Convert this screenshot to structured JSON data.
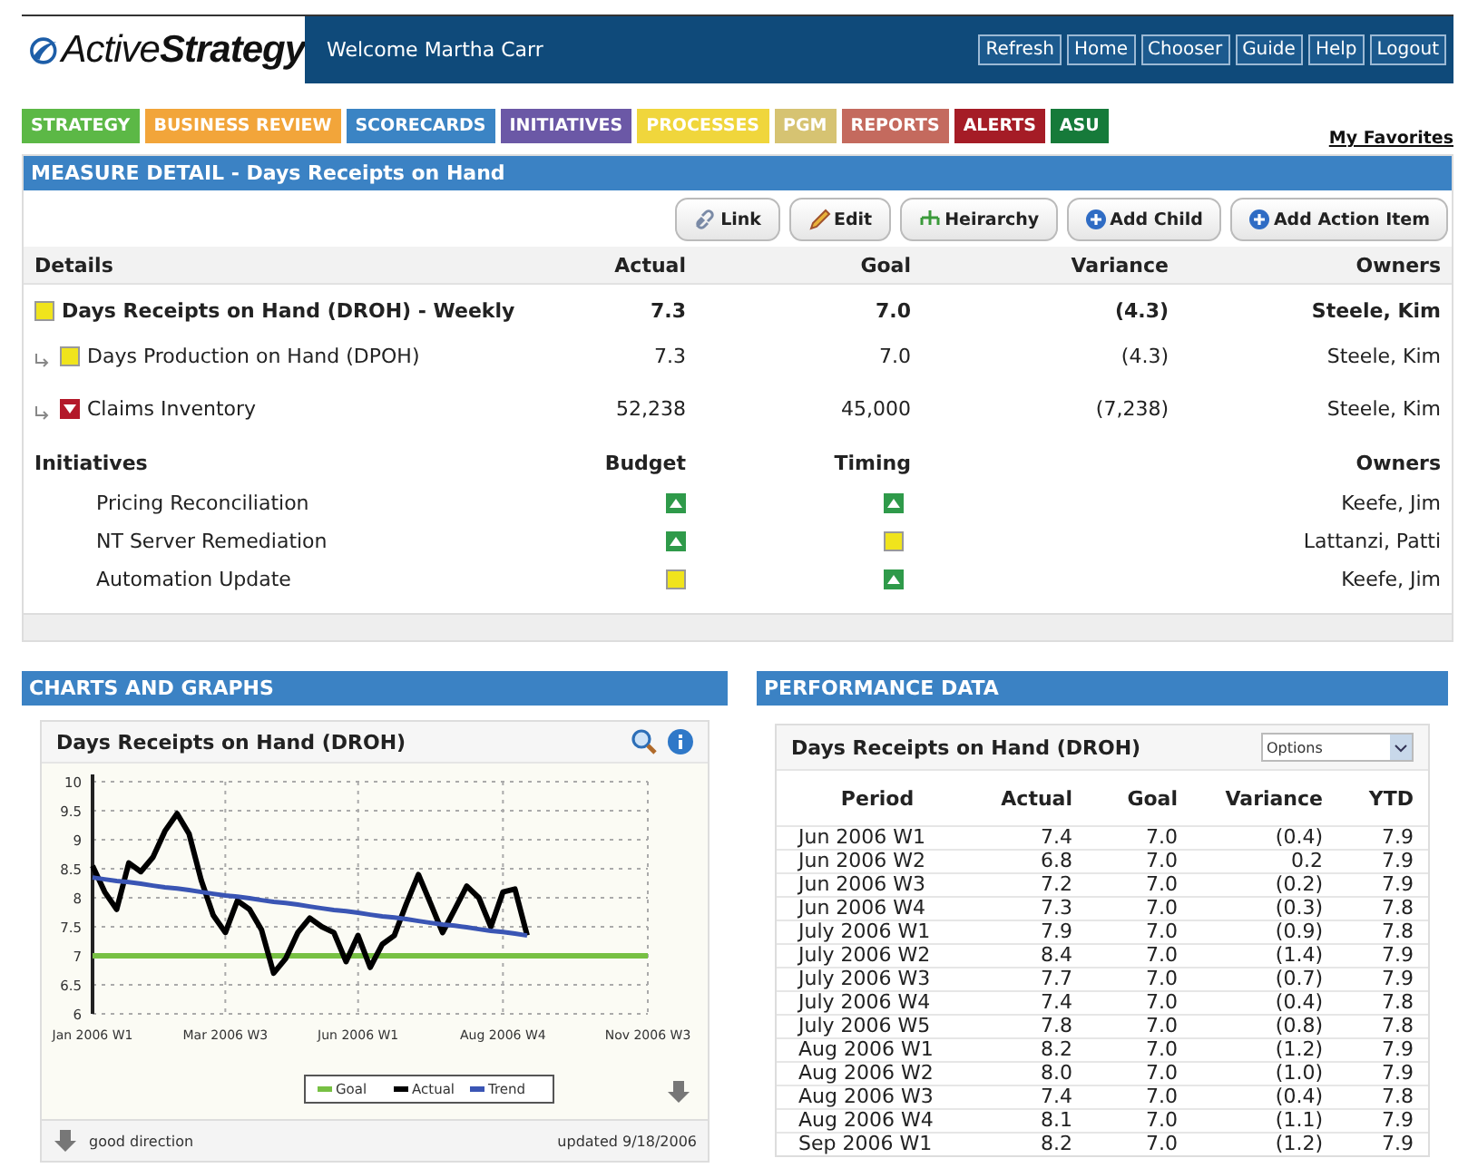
{
  "header": {
    "logo": {
      "word1": "Active",
      "word2": "Strategy"
    },
    "welcome": "Welcome Martha Carr",
    "buttons": [
      "Refresh",
      "Home",
      "Chooser",
      "Guide",
      "Help",
      "Logout"
    ]
  },
  "tabs": [
    {
      "label": "STRATEGY",
      "color": "#5cb846"
    },
    {
      "label": "BUSINESS REVIEW",
      "color": "#f2a53a"
    },
    {
      "label": "SCORECARDS",
      "color": "#3b84c4"
    },
    {
      "label": "INITIATIVES",
      "color": "#6b58a6"
    },
    {
      "label": "PROCESSES",
      "color": "#f0d63c"
    },
    {
      "label": "PGM",
      "color": "#d6c372"
    },
    {
      "label": "REPORTS",
      "color": "#c46a5e"
    },
    {
      "label": "ALERTS",
      "color": "#a51c26"
    },
    {
      "label": "ASU",
      "color": "#167a3a"
    }
  ],
  "favorites": "My Favorites",
  "measure_detail": {
    "title": "MEASURE DETAIL - Days Receipts on Hand",
    "actions": [
      {
        "label": "Link",
        "kind": "link"
      },
      {
        "label": "Edit",
        "kind": "edit"
      },
      {
        "label": "Heirarchy",
        "kind": "hierarchy"
      },
      {
        "label": "Add Child",
        "kind": "add"
      },
      {
        "label": "Add Action Item",
        "kind": "add"
      }
    ],
    "columns": [
      "Details",
      "Actual",
      "Goal",
      "Variance",
      "Owners"
    ],
    "measures": [
      {
        "name": "Days Receipts on Hand (DROH) - Weekly",
        "status": {
          "kind": "square"
        },
        "actual": "7.3",
        "goal": "7.0",
        "variance": "(4.3)",
        "owner": "Steele, Kim",
        "children": [
          {
            "name": "Days Production on Hand (DPOH)",
            "status": {
              "kind": "square"
            },
            "actual": "7.3",
            "goal": "7.0",
            "variance": "(4.3)",
            "owner": "Steele, Kim"
          },
          {
            "name": "Claims Inventory",
            "status": {
              "kind": "down"
            },
            "actual": "52,238",
            "goal": "45,000",
            "variance": "(7,238)",
            "owner": "Steele, Kim"
          }
        ]
      }
    ],
    "initiative_columns": [
      "Initiatives",
      "Budget",
      "Timing",
      "Owners"
    ],
    "initiatives": [
      {
        "name": "Pricing Reconciliation",
        "budget": {
          "kind": "up"
        },
        "timing": {
          "kind": "up"
        },
        "owner": "Keefe, Jim"
      },
      {
        "name": "NT Server Remediation",
        "budget": {
          "kind": "up"
        },
        "timing": {
          "kind": "square"
        },
        "owner": "Lattanzi, Patti"
      },
      {
        "name": "Automation Update",
        "budget": {
          "kind": "square"
        },
        "timing": {
          "kind": "up"
        },
        "owner": "Keefe, Jim"
      }
    ]
  },
  "charts_panel": {
    "title": "CHARTS AND GRAPHS",
    "chart_title": "Days Receipts on Hand (DROH)",
    "chart_data": {
      "type": "line",
      "grid": true,
      "legend": "bottom",
      "categories": [
        "Jan 2006 W1",
        null,
        null,
        null,
        null,
        null,
        null,
        null,
        null,
        null,
        null,
        "Mar 2006 W3",
        null,
        null,
        null,
        null,
        null,
        null,
        null,
        null,
        null,
        null,
        "Jun 2006 W1",
        null,
        null,
        null,
        null,
        null,
        null,
        null,
        null,
        null,
        null,
        null,
        "Aug 2006 W4",
        null,
        null,
        null,
        null,
        null,
        null,
        null,
        null,
        null,
        null,
        null,
        "Nov 2006 W3"
      ],
      "ylim": [
        6,
        10
      ],
      "yticks": [
        6,
        6.5,
        7,
        7.5,
        8,
        8.5,
        9,
        9.5,
        10
      ],
      "series": [
        {
          "name": "Goal",
          "color": "#77c043",
          "values": [
            7,
            7,
            7,
            7,
            7,
            7,
            7,
            7,
            7,
            7,
            7,
            7,
            7,
            7,
            7,
            7,
            7,
            7,
            7,
            7,
            7,
            7,
            7,
            7,
            7,
            7,
            7,
            7,
            7,
            7,
            7,
            7,
            7,
            7,
            7,
            7,
            7,
            7,
            7,
            7,
            7,
            7,
            7,
            7,
            7,
            7,
            7
          ]
        },
        {
          "name": "Actual",
          "color": "#000000",
          "values": [
            8.55,
            8.1,
            7.8,
            8.6,
            8.45,
            8.7,
            9.15,
            9.45,
            9.1,
            8.3,
            7.7,
            7.4,
            7.95,
            7.8,
            7.45,
            6.7,
            6.95,
            7.4,
            7.65,
            7.5,
            7.4,
            6.9,
            7.35,
            6.8,
            7.2,
            7.35,
            7.9,
            8.4,
            7.9,
            7.4,
            7.8,
            8.2,
            8.0,
            7.5,
            8.1,
            8.15,
            7.35,
            null,
            null,
            null,
            null,
            null,
            null,
            null,
            null,
            null,
            null
          ]
        },
        {
          "name": "Trend",
          "color": "#3a55b4",
          "values": [
            8.35,
            8.32,
            8.29,
            8.27,
            8.24,
            8.21,
            8.18,
            8.16,
            8.13,
            8.1,
            8.07,
            8.04,
            8.02,
            7.99,
            7.96,
            7.93,
            7.91,
            7.88,
            7.85,
            7.82,
            7.79,
            7.77,
            7.74,
            7.71,
            7.68,
            7.66,
            7.63,
            7.6,
            7.57,
            7.54,
            7.52,
            7.49,
            7.46,
            7.43,
            7.41,
            7.38,
            7.35,
            null,
            null,
            null,
            null,
            null,
            null,
            null,
            null,
            null,
            null
          ]
        }
      ]
    },
    "direction": "good direction",
    "updated": "updated 9/18/2006"
  },
  "performance_panel": {
    "title": "PERFORMANCE DATA",
    "table_title": "Days Receipts on Hand (DROH)",
    "options": "Options",
    "columns": [
      "Period",
      "Actual",
      "Goal",
      "Variance",
      "YTD"
    ],
    "rows": [
      [
        "Jun 2006 W1",
        "7.4",
        "7.0",
        "(0.4)",
        "7.9"
      ],
      [
        "Jun 2006 W2",
        "6.8",
        "7.0",
        "0.2",
        "7.9"
      ],
      [
        "Jun 2006 W3",
        "7.2",
        "7.0",
        "(0.2)",
        "7.9"
      ],
      [
        "Jun 2006 W4",
        "7.3",
        "7.0",
        "(0.3)",
        "7.8"
      ],
      [
        "July 2006 W1",
        "7.9",
        "7.0",
        "(0.9)",
        "7.8"
      ],
      [
        "July 2006 W2",
        "8.4",
        "7.0",
        "(1.4)",
        "7.9"
      ],
      [
        "July 2006 W3",
        "7.7",
        "7.0",
        "(0.7)",
        "7.9"
      ],
      [
        "July 2006 W4",
        "7.4",
        "7.0",
        "(0.4)",
        "7.8"
      ],
      [
        "July 2006 W5",
        "7.8",
        "7.0",
        "(0.8)",
        "7.8"
      ],
      [
        "Aug 2006 W1",
        "8.2",
        "7.0",
        "(1.2)",
        "7.9"
      ],
      [
        "Aug 2006 W2",
        "8.0",
        "7.0",
        "(1.0)",
        "7.9"
      ],
      [
        "Aug 2006 W3",
        "7.4",
        "7.0",
        "(0.4)",
        "7.8"
      ],
      [
        "Aug 2006 W4",
        "8.1",
        "7.0",
        "(1.1)",
        "7.9"
      ],
      [
        "Sep 2006 W1",
        "8.2",
        "7.0",
        "(1.2)",
        "7.9"
      ]
    ]
  }
}
